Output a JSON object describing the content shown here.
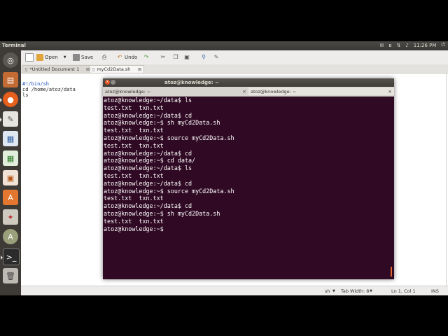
{
  "top_panel": {
    "app_title": "Terminal",
    "clock": "11:26 PM",
    "indicators": [
      "mail-icon",
      "bluetooth-icon",
      "network-icon",
      "volume-icon",
      "power-icon"
    ]
  },
  "launcher": {
    "items": [
      "ubuntu-dash-icon",
      "files-icon",
      "firefox-icon",
      "text-editor-icon",
      "writer-icon",
      "calc-icon",
      "impress-icon",
      "software-center-icon",
      "settings-icon",
      "update-manager-icon",
      "terminal-icon",
      "trash-icon"
    ]
  },
  "gedit": {
    "toolbar": {
      "open_label": "Open",
      "save_label": "Save",
      "undo_label": "Undo"
    },
    "tabs": [
      {
        "label": "*Untitled Document 1"
      },
      {
        "label": "myCd2Data.sh"
      }
    ],
    "editor_lines": [
      "#!/bin/sh",
      "cd /home/atoz/data",
      "ls"
    ],
    "statusbar": {
      "language": "sh",
      "tab_width": "Tab Width: 8",
      "position": "Ln 1, Col 1",
      "mode": "INS"
    }
  },
  "terminal": {
    "title": "atoz@knowledge: ~",
    "tabs": [
      {
        "label": "atoz@knowledge: ~"
      },
      {
        "label": "atoz@knowledge: ~"
      }
    ],
    "lines": [
      "atoz@knowledge:~/data$ ls",
      "test.txt  txn.txt",
      "atoz@knowledge:~/data$ cd",
      "atoz@knowledge:~$ sh myCd2Data.sh",
      "test.txt  txn.txt",
      "atoz@knowledge:~$ source myCd2Data.sh",
      "test.txt  txn.txt",
      "atoz@knowledge:~/data$ cd",
      "atoz@knowledge:~$ cd data/",
      "atoz@knowledge:~/data$ ls",
      "test.txt  txn.txt",
      "atoz@knowledge:~/data$ cd",
      "atoz@knowledge:~$ source myCd2Data.sh",
      "test.txt  txn.txt",
      "atoz@knowledge:~/data$ cd",
      "atoz@knowledge:~$ sh myCd2Data.sh",
      "test.txt  txn.txt",
      "atoz@knowledge:~$ "
    ],
    "colors": {
      "background": "#300a24",
      "foreground": "#ffffff",
      "scroll_thumb": "#e0672f"
    }
  }
}
